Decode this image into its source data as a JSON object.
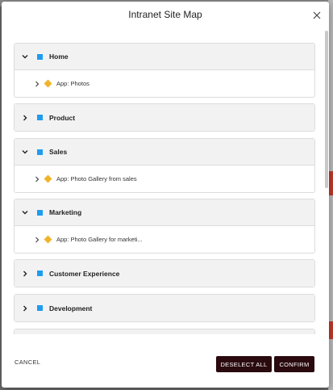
{
  "dialog": {
    "title": "Intranet Site Map"
  },
  "sections": [
    {
      "label": "Home",
      "expanded": true,
      "items": [
        "App: Photos"
      ]
    },
    {
      "label": "Product",
      "expanded": false,
      "items": []
    },
    {
      "label": "Sales",
      "expanded": true,
      "items": [
        "App: Photo Gallery from sales"
      ]
    },
    {
      "label": "Marketing",
      "expanded": true,
      "items": [
        "App: Photo Gallery for marketi..."
      ]
    },
    {
      "label": "Customer Experience",
      "expanded": false,
      "items": []
    },
    {
      "label": "Development",
      "expanded": false,
      "items": []
    }
  ],
  "footer": {
    "cancel_label": "CANCEL",
    "deselect_label": "DESELECT ALL",
    "confirm_label": "CONFIRM"
  },
  "colors": {
    "section_marker": "#1e9cf0",
    "app_marker": "#f0b429",
    "button_dark": "#2a0a0e"
  },
  "icons": {
    "close": "close-icon",
    "expanded": "chevron-down-icon",
    "collapsed": "chevron-right-icon",
    "section_marker": "square-icon",
    "app_marker": "diamond-icon"
  }
}
